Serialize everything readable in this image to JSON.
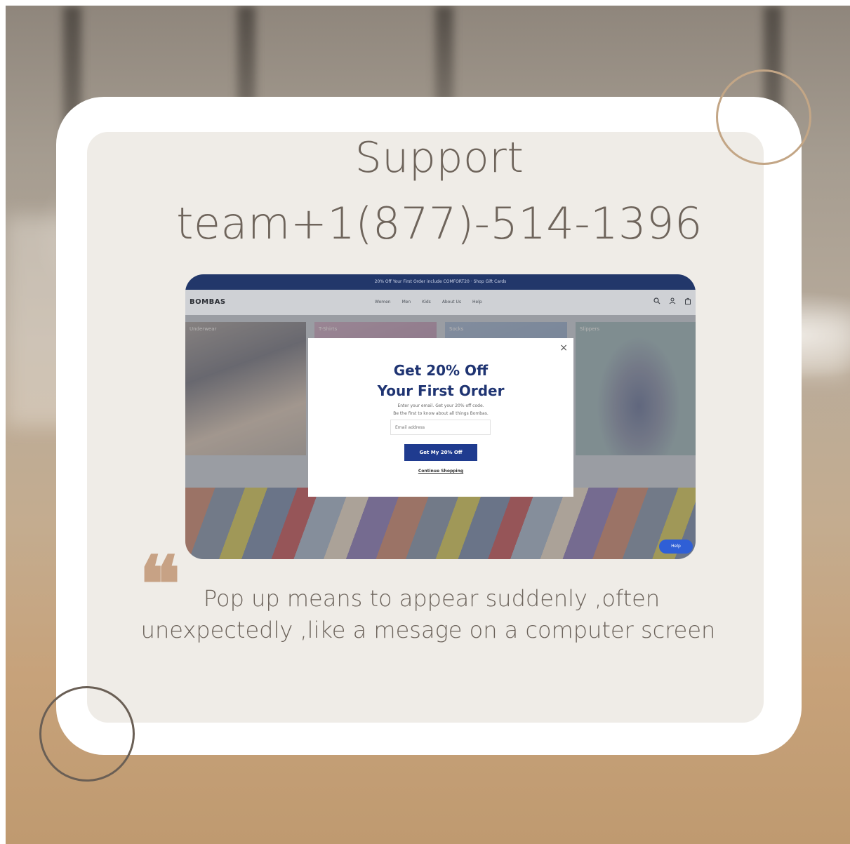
{
  "headline": {
    "line1": "Support",
    "line2": "team+1(877)-514-1396"
  },
  "screenshot": {
    "promo_bar": "20% Off Your First Order include COMFORT20 · Shop Gift Cards",
    "brand": "BOMBAS",
    "nav_links": [
      "Women",
      "Men",
      "Kids",
      "About Us",
      "Help"
    ],
    "icons": [
      "search-icon",
      "account-icon",
      "bag-icon"
    ],
    "tiles": [
      "Underwear",
      "T-Shirts",
      "Socks",
      "Slippers"
    ],
    "chat_label": "Help",
    "popup": {
      "title_line1": "Get 20% Off",
      "title_line2": "Your First Order",
      "copy_line1": "Enter your email. Get your 20% off code.",
      "copy_line2": "Be the first to know about all things Bombas.",
      "email_placeholder": "Email address",
      "cta": "Get My 20% Off",
      "continue": "Continue Shopping",
      "close": "×"
    }
  },
  "quote": {
    "mark": "❝",
    "line1": "Pop up means  to appear suddenly ,often",
    "line2": "unexpectedly ,like a mesage on a computer screen"
  },
  "colors": {
    "heading_text": "#6e645b",
    "accent_ring": "#c3a686",
    "dark_ring": "#6a5f55",
    "popup_navy": "#1f3472"
  }
}
